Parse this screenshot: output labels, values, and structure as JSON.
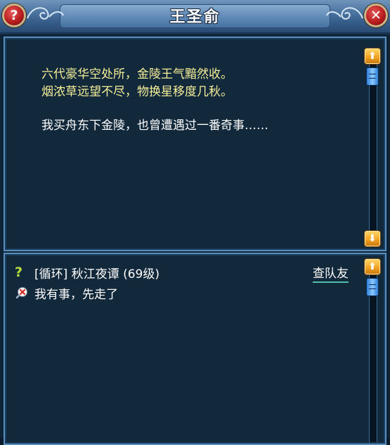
{
  "window": {
    "title": "王圣俞",
    "help_glyph": "?",
    "close_glyph": "✕"
  },
  "dialogue": {
    "poem_line1": "六代豪华空处所，金陵王气黯然收。",
    "poem_line2": "烟浓草远望不尽，物换星移度几秋。",
    "narration": "我买舟东下金陵，也曾遭遇过一番奇事……"
  },
  "options": {
    "quest_mark": "?",
    "quest_label": "[循环] 秋江夜谭 (69级)",
    "team_link": "查队友",
    "leave_label": "我有事，先走了"
  },
  "scroll_glyphs": {
    "up": "⬆",
    "down": "⬇"
  },
  "colors": {
    "poem_text": "#f5ef98",
    "normal_text": "#ffffff",
    "panel_border": "#5a8fbd",
    "scroll_button": "#f0a020",
    "close_button": "#b91d1d"
  },
  "icons": {
    "help": "question-mark-icon",
    "close": "close-icon",
    "quest": "quest-question-icon",
    "leave": "leave-chat-icon"
  }
}
